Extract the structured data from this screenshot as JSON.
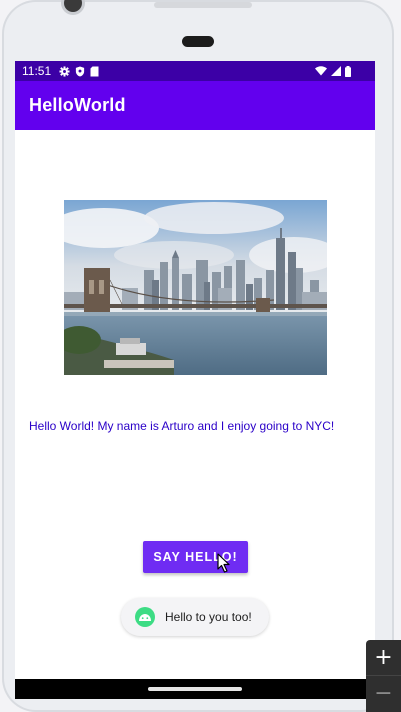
{
  "status_bar": {
    "time": "11:51",
    "left_icons": [
      "gear-icon",
      "shield-icon",
      "sd-card-icon"
    ],
    "right_icons": [
      "wifi-icon",
      "signal-icon",
      "battery-icon"
    ]
  },
  "app_bar": {
    "title": "HelloWorld"
  },
  "main": {
    "image_subject": "Brooklyn Bridge and Manhattan skyline",
    "message": "Hello World! My name is Arturo and I enjoy going to NYC!",
    "button_label": "SAY HELLO!"
  },
  "toast": {
    "text": "Hello to you too!",
    "icon": "android-icon"
  },
  "emulator_controls": {
    "zoom_in_label": "+",
    "zoom_out_label": "−"
  },
  "colors": {
    "status_bar": "#3c00a6",
    "app_bar": "#6200ee",
    "button": "#6f2cf3",
    "message_text": "#2a00c8",
    "toast_icon": "#3ddc84"
  }
}
